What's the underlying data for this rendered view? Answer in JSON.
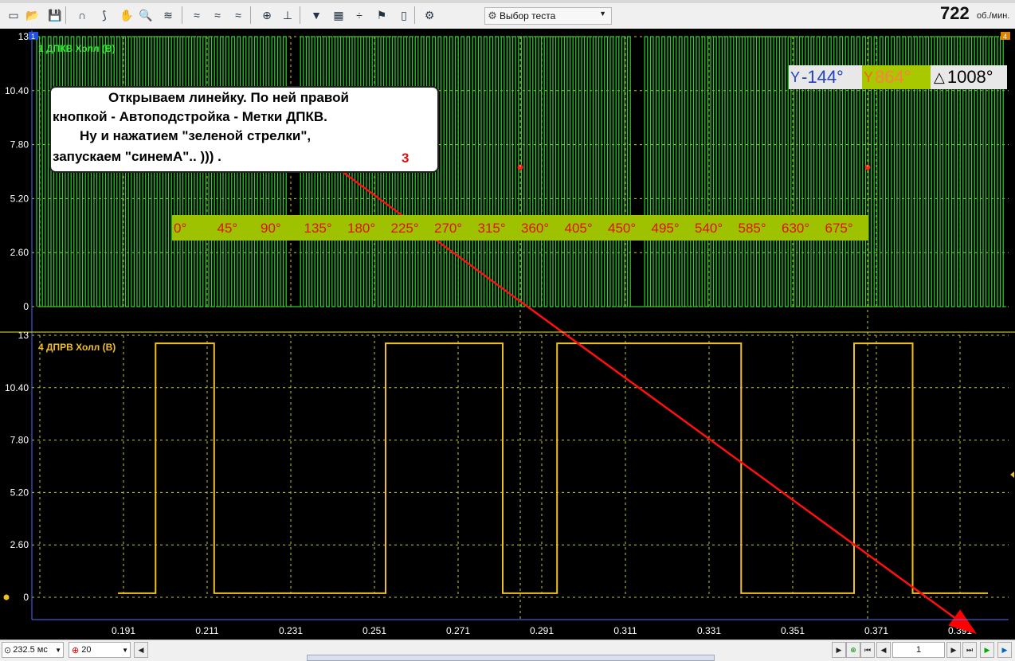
{
  "toolbar": {
    "icons": [
      "new-file-icon",
      "open-folder-icon",
      "save-icon",
      "cursor-mode-icon",
      "measure-mode-icon",
      "hand-pan-icon",
      "zoom-icon",
      "amplitude-scale-icon",
      "filter-wave-icon",
      "filter-wave-2-icon",
      "filter-wave-3-icon",
      "auto-scale-icon",
      "y-zero-icon",
      "auto-trigger-icon",
      "grid-icon",
      "ruler-icon",
      "marker-flag-icon",
      "document-icon",
      "auto-icon"
    ],
    "test_select": "Выбор теста",
    "rpm_value": "722",
    "rpm_unit": "об./мин."
  },
  "cursors": {
    "left": "-144°",
    "right": "864°",
    "delta": "1008°"
  },
  "annotation": {
    "line1": "Открываем линейку. По ней правой",
    "line2": "кнопкой - Автоподстройка - Метки ДПКВ.",
    "line3": "Ну и нажатием \"зеленой стрелки\",",
    "line4": "запускаем \"синемА\".. ))) .",
    "step_number": "3"
  },
  "degree_ruler": [
    "0°",
    "45°",
    "90°",
    "135°",
    "180°",
    "225°",
    "270°",
    "315°",
    "360°",
    "405°",
    "450°",
    "495°",
    "540°",
    "585°",
    "630°",
    "675°"
  ],
  "channels": [
    {
      "number": "1",
      "label": "1 ДПКВ Холл (В)",
      "color": "#28d428"
    },
    {
      "number": "4",
      "label": "4 ДПРВ  Холл (В)",
      "color": "#f0c020"
    }
  ],
  "chart_data": [
    {
      "type": "line",
      "title": "1 ДПКВ Холл (В)",
      "y_ticks": [
        "13",
        "10.40",
        "7.80",
        "5.20",
        "2.60",
        "0"
      ],
      "ylim": [
        0,
        13
      ],
      "series": [
        {
          "name": "1 ДПКВ Холл (В)",
          "pattern": "square wave, 60-2 tooth crank signal, 0–13 V",
          "values": [
            0,
            13
          ]
        }
      ]
    },
    {
      "type": "line",
      "title": "4 ДПРВ  Холл (В)",
      "y_ticks": [
        "13",
        "10.40",
        "7.80",
        "5.20",
        "2.60",
        "0"
      ],
      "ylim": [
        0,
        13
      ],
      "x_ticks": [
        "0.191",
        "0.211",
        "0.231",
        "0.251",
        "0.271",
        "0.291",
        "0.311",
        "0.331",
        "0.351",
        "0.371",
        "0.391"
      ],
      "x": [
        0.191,
        0.2,
        0.2,
        0.214,
        0.214,
        0.255,
        0.255,
        0.283,
        0.283,
        0.296,
        0.296,
        0.34,
        0.34,
        0.367,
        0.367,
        0.381,
        0.381,
        0.399
      ],
      "series": [
        {
          "name": "4 ДПРВ  Холл (В)",
          "values": [
            0.2,
            0.2,
            12.6,
            12.6,
            0.2,
            0.2,
            12.6,
            12.6,
            0.2,
            0.2,
            12.6,
            12.6,
            0.2,
            0.2,
            12.6,
            12.6,
            0.2,
            0.2
          ]
        }
      ]
    }
  ],
  "statusbar": {
    "time_per_div": "232.5 мс",
    "count": "20",
    "page": "1"
  }
}
